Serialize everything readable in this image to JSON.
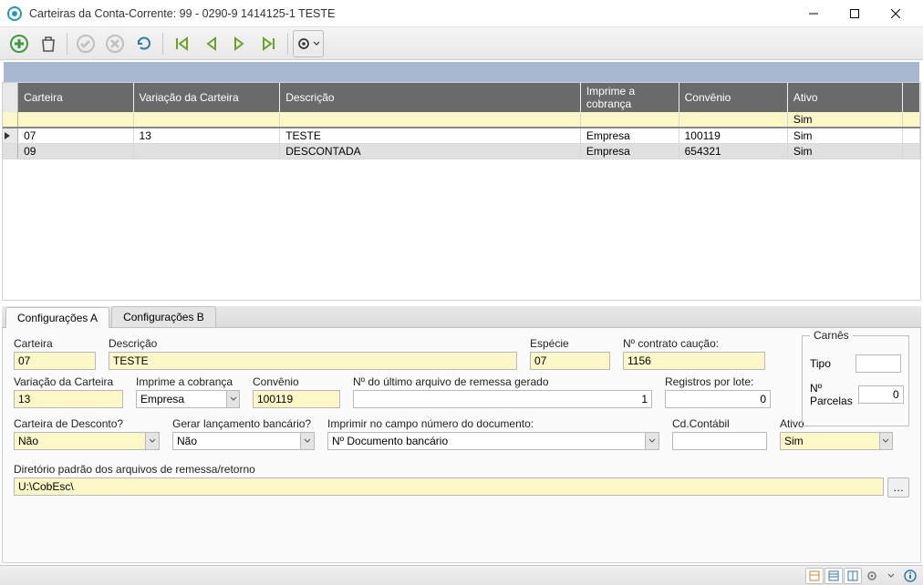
{
  "window": {
    "title": "Carteiras da Conta-Corrente: 99 - 0290-9 1414125-1 TESTE"
  },
  "grid": {
    "headers": {
      "carteira": "Carteira",
      "variacao": "Variação da Carteira",
      "descricao": "Descrição",
      "imprime": "Imprime a cobrança",
      "convenio": "Convênio",
      "ativo": "Ativo"
    },
    "newrow": {
      "ativo": "Sim"
    },
    "rows": [
      {
        "carteira": "07",
        "variacao": "13",
        "descricao": "TESTE",
        "imprime": "Empresa",
        "convenio": "100119",
        "ativo": "Sim"
      },
      {
        "carteira": "09",
        "variacao": "",
        "descricao": "DESCONTADA",
        "imprime": "Empresa",
        "convenio": "654321",
        "ativo": "Sim"
      }
    ]
  },
  "tabs": {
    "a": "Configurações A",
    "b": "Configurações B"
  },
  "form": {
    "labels": {
      "carteira": "Carteira",
      "descricao": "Descrição",
      "especie": "Espécie",
      "contrato_caucao": "Nº contrato caução:",
      "variacao": "Variação da Carteira",
      "imprime": "Imprime a cobrança",
      "convenio": "Convênio",
      "ultimo_arquivo": "Nº do último arquivo de remessa gerado",
      "registros_lote": "Registros por lote:",
      "cart_desc": "Carteira de Desconto?",
      "gerar_lanc": "Gerar lançamento bancário?",
      "imprimir_campo": "Imprimir no campo número do documento:",
      "cd_contabil": "Cd.Contábil",
      "ativo": "Ativo",
      "diretorio": "Diretório padrão dos arquivos de remessa/retorno"
    },
    "values": {
      "carteira": "07",
      "descricao": "TESTE",
      "especie": "07",
      "contrato_caucao": "1156",
      "variacao": "13",
      "imprime": "Empresa",
      "convenio": "100119",
      "ultimo_arquivo": "1",
      "registros_lote": "0",
      "cart_desc": "Não",
      "gerar_lanc": "Não",
      "imprimir_campo": "Nº Documento bancário",
      "cd_contabil": "",
      "ativo": "Sim",
      "diretorio": "U:\\CobEsc\\"
    },
    "carnes": {
      "legend": "Carnês",
      "tipo_label": "Tipo",
      "parcelas_label": "Nº Parcelas",
      "tipo": "",
      "parcelas": "0"
    }
  }
}
